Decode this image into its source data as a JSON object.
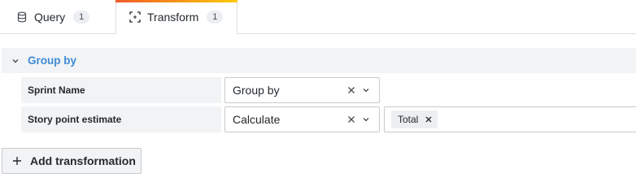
{
  "tabs": [
    {
      "label": "Query",
      "count": "1",
      "icon": "database-icon",
      "active": false
    },
    {
      "label": "Transform",
      "count": "1",
      "icon": "transform-icon",
      "active": true
    }
  ],
  "colors": {
    "accent_blue": "#3e8bd6",
    "active_tab_gradient_start": "#f05a28",
    "active_tab_gradient_end": "#fbca0a"
  },
  "transformation": {
    "title": "Group by",
    "rows": [
      {
        "field": "Sprint Name",
        "action": "Group by",
        "calculations": []
      },
      {
        "field": "Story point estimate",
        "action": "Calculate",
        "calculations": [
          "Total"
        ]
      }
    ]
  },
  "add_button": {
    "label": "Add transformation"
  }
}
